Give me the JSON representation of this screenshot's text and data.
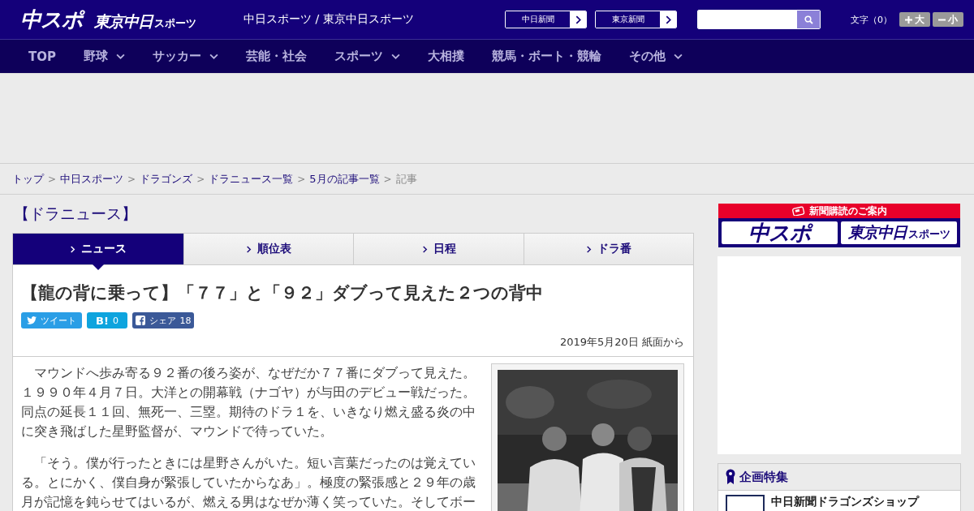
{
  "header": {
    "logos": [
      {
        "main": "中スポ"
      },
      {
        "main": "東京中日",
        "small": "スポーツ"
      }
    ],
    "site_title": "中日スポーツ / 東京中日スポーツ",
    "paper_links": [
      "中日新聞",
      "東京新聞"
    ],
    "font_size": {
      "label": "文字（0）",
      "buttons": [
        {
          "kind": "plus",
          "label": "大"
        },
        {
          "kind": "minus",
          "label": "小"
        }
      ]
    }
  },
  "nav": [
    {
      "label": "TOP",
      "dropdown": false
    },
    {
      "label": "野球",
      "dropdown": true
    },
    {
      "label": "サッカー",
      "dropdown": true
    },
    {
      "label": "芸能・社会",
      "dropdown": false
    },
    {
      "label": "スポーツ",
      "dropdown": true
    },
    {
      "label": "大相撲",
      "dropdown": false
    },
    {
      "label": "競馬・ボート・競輪",
      "dropdown": false
    },
    {
      "label": "その他",
      "dropdown": true
    }
  ],
  "breadcrumb": {
    "separator": ">",
    "items": [
      {
        "label": "トップ",
        "link": true
      },
      {
        "label": "中日スポーツ",
        "link": true
      },
      {
        "label": "ドラゴンズ",
        "link": true
      },
      {
        "label": "ドラニュース一覧",
        "link": true
      },
      {
        "label": "5月の記事一覧",
        "link": true
      },
      {
        "label": "記事",
        "link": false
      }
    ]
  },
  "section_title": "【ドラニュース】",
  "tabs": [
    {
      "label": "ニュース",
      "selected": true
    },
    {
      "label": "順位表",
      "selected": false
    },
    {
      "label": "日程",
      "selected": false
    },
    {
      "label": "ドラ番",
      "selected": false
    }
  ],
  "article": {
    "title": "【龍の背に乗って】「７７」と「９２」ダブって見えた２つの背中",
    "share": [
      {
        "kind": "twitter",
        "label": "ツイート"
      },
      {
        "kind": "hatena",
        "label": "B!",
        "count": "0"
      },
      {
        "kind": "facebook",
        "label": "シェア",
        "count": "18"
      }
    ],
    "date": "2019年5月20日 紙面から",
    "paragraphs": [
      "　マウンドへ歩み寄る９２番の後ろ姿が、なぜだか７７番にダブって見えた。１９９０年４月７日。大洋との開幕戦（ナゴヤ）が与田のデビュー戦だった。同点の延長１１回、無死一、三塁。期待のドラ１を、いきなり燃え盛る炎の中に突き飛ばした星野監督が、マウンドで待っていた。",
      "　「そう。僕が行ったときには星野さんがいた。短い言葉だったのは覚えている。とにかく、僕自身が緊張していたからなあ」。極度の緊張感と２９年の歳月が記憶を鈍らせてはいるが、燃える男はなぜか薄く笑っていた。そしてボー"
    ],
    "photo": {
      "kind": "picture"
    }
  },
  "sidebar": {
    "subscribe": {
      "title": "新聞購読のご案内",
      "logos": [
        {
          "main": "中スポ"
        },
        {
          "main": "東京中日",
          "small": "スポーツ"
        }
      ]
    },
    "feature": {
      "title": "企画特集",
      "items": [
        {
          "label": "中日新聞ドラゴンズショップ"
        }
      ]
    }
  }
}
